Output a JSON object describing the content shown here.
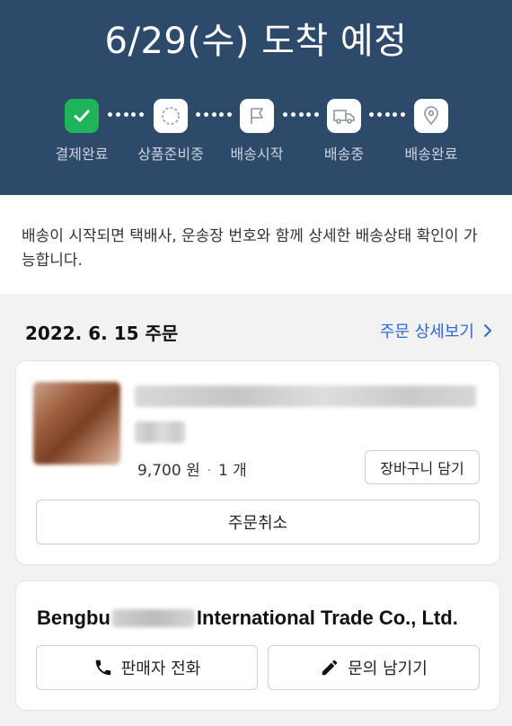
{
  "header": {
    "title": "6/29(수) 도착 예정",
    "steps": [
      {
        "label": "결제완료",
        "icon": "check-icon",
        "done": true
      },
      {
        "label": "상품준비중",
        "icon": "loading-circle-icon",
        "done": false
      },
      {
        "label": "배송시작",
        "icon": "flag-icon",
        "done": false
      },
      {
        "label": "배송중",
        "icon": "truck-icon",
        "done": false
      },
      {
        "label": "배송완료",
        "icon": "location-pin-icon",
        "done": false
      }
    ]
  },
  "notice": {
    "text": "배송이 시작되면 택배사, 운송장 번호와 함께 상세한 배송상태 확인이 가능합니다."
  },
  "order": {
    "date": "2022. 6. 15 주문",
    "detail_link": "주문 상세보기",
    "item": {
      "price": "9,700 원",
      "separator": "·",
      "quantity": "1 개",
      "cart_button": "장바구니 담기"
    },
    "cancel_button": "주문취소"
  },
  "seller": {
    "name_prefix": "Bengbu",
    "name_suffix": "International Trade Co., Ltd.",
    "call_button": "판매자 전화",
    "inquiry_button": "문의 남기기"
  },
  "colors": {
    "header_bg": "#2e4a6b",
    "done_green": "#1eb45a",
    "link_blue": "#2f68d6"
  }
}
